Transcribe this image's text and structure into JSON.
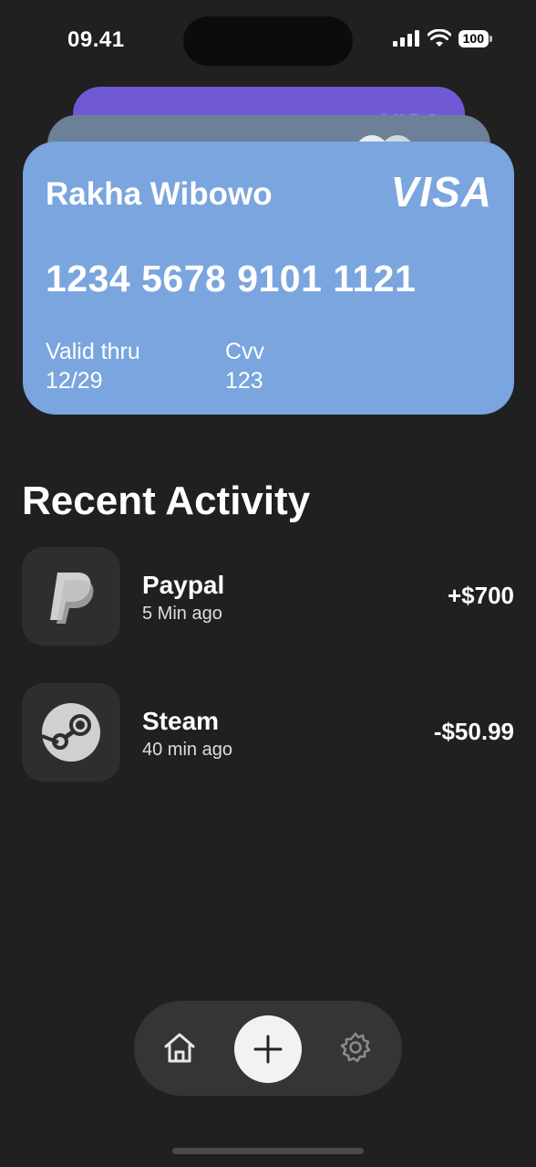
{
  "status": {
    "time": "09.41",
    "battery": "100"
  },
  "cards": {
    "back_brand": "VISA",
    "front": {
      "name": "Rakha Wibowo",
      "brand": "VISA",
      "number": "1234 5678 9101 1121",
      "valid_label": "Valid thru",
      "valid_value": "12/29",
      "cvv_label": "Cvv",
      "cvv_value": "123",
      "color": "#7aa5de"
    },
    "back_colors": [
      "#7159d6",
      "#6c8197"
    ]
  },
  "recent": {
    "title": "Recent Activity",
    "items": [
      {
        "name": "Paypal",
        "time": "5 Min ago",
        "amount": "+$700",
        "icon": "paypal-icon"
      },
      {
        "name": "Steam",
        "time": "40 min ago",
        "amount": "-$50.99",
        "icon": "steam-icon"
      }
    ]
  },
  "nav": {
    "items": [
      "home-icon",
      "plus-icon",
      "gear-icon"
    ]
  }
}
